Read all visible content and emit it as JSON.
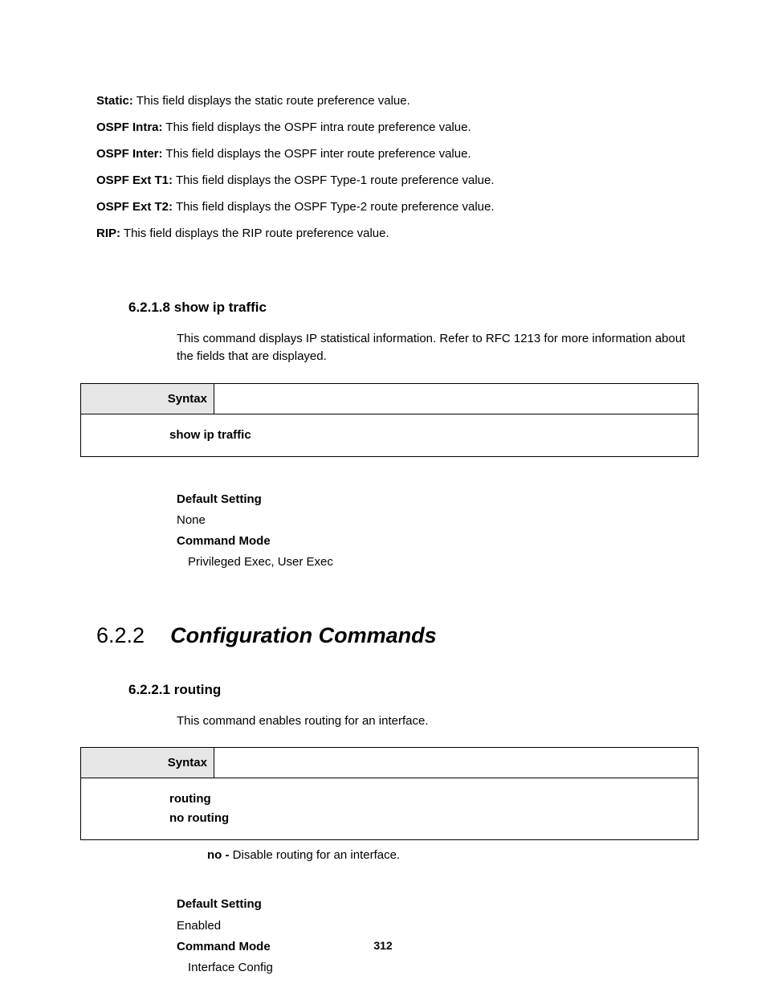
{
  "fields": [
    {
      "label": "Static:",
      "desc": "This field displays the static route preference value."
    },
    {
      "label": "OSPF Intra:",
      "desc": "This field displays the OSPF intra route preference value."
    },
    {
      "label": "OSPF Inter:",
      "desc": "This field displays the OSPF inter route preference value."
    },
    {
      "label": "OSPF Ext T1:",
      "desc": "This field displays the OSPF Type-1 route preference value."
    },
    {
      "label": "OSPF Ext T2:",
      "desc": "This field displays the OSPF Type-2 route preference value."
    },
    {
      "label": "RIP:",
      "desc": "This field displays the RIP route preference value."
    }
  ],
  "sub1": {
    "number": "6.2.1.8",
    "title": "show ip traffic",
    "body": "This command displays IP statistical information. Refer to RFC 1213 for more information about the fields that are displayed.",
    "syntax_label": "Syntax",
    "syntax_body": "show ip traffic",
    "default_label": "Default Setting",
    "default_value": "None",
    "mode_label": "Command Mode",
    "mode_value": "Privileged Exec, User Exec"
  },
  "section": {
    "number": "6.2.2",
    "title": "Configuration Commands"
  },
  "sub2": {
    "number": "6.2.2.1",
    "title": "routing",
    "body": "This command enables routing for an interface.",
    "syntax_label": "Syntax",
    "syntax_line1": "routing",
    "syntax_line2": "no routing",
    "no_label": "no - ",
    "no_desc": "Disable routing for an interface.",
    "default_label": "Default Setting",
    "default_value": "Enabled",
    "mode_label": "Command Mode",
    "mode_value": "Interface Config"
  },
  "page_number": "312"
}
